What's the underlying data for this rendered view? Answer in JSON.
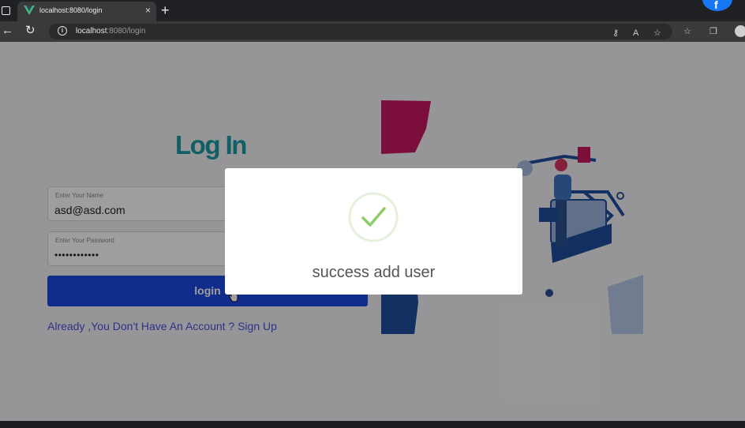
{
  "browser": {
    "tab_title": "localhost:8080/login",
    "url_host": "localhost",
    "url_rest": ":8080/login",
    "fb_letter": "f"
  },
  "page": {
    "title": "Log In",
    "name_field": {
      "label": "Enter Your Name",
      "value": "asd@asd.com"
    },
    "password_field": {
      "label": "Enter Your Password",
      "value": "••••••••••••"
    },
    "login_button": "login",
    "signup_link": "Already ,You Don't Have An Account ? Sign Up"
  },
  "modal": {
    "message": "success add user",
    "icon": "success-check-icon"
  },
  "colors": {
    "title": "#1a9aa4",
    "button": "#1c49e0",
    "link": "#4a4fd8",
    "check": "#8fcc6a"
  }
}
